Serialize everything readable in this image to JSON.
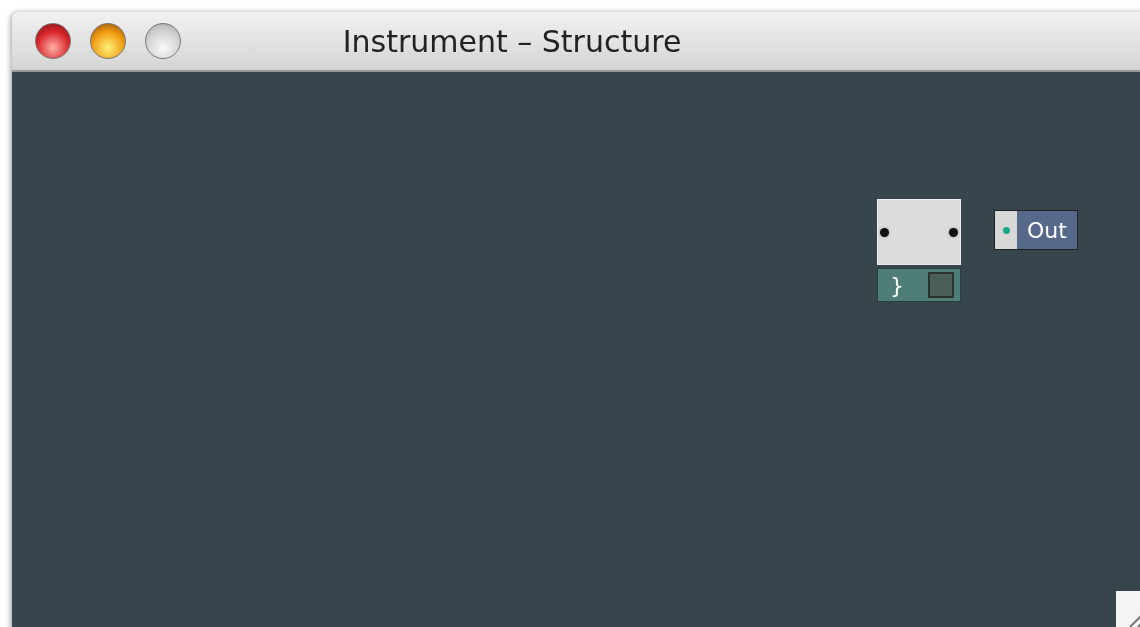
{
  "window": {
    "title": "Instrument – Structure"
  },
  "modules": [
    {
      "kind": "macro",
      "label": "}"
    },
    {
      "kind": "output",
      "label": "Out"
    }
  ]
}
